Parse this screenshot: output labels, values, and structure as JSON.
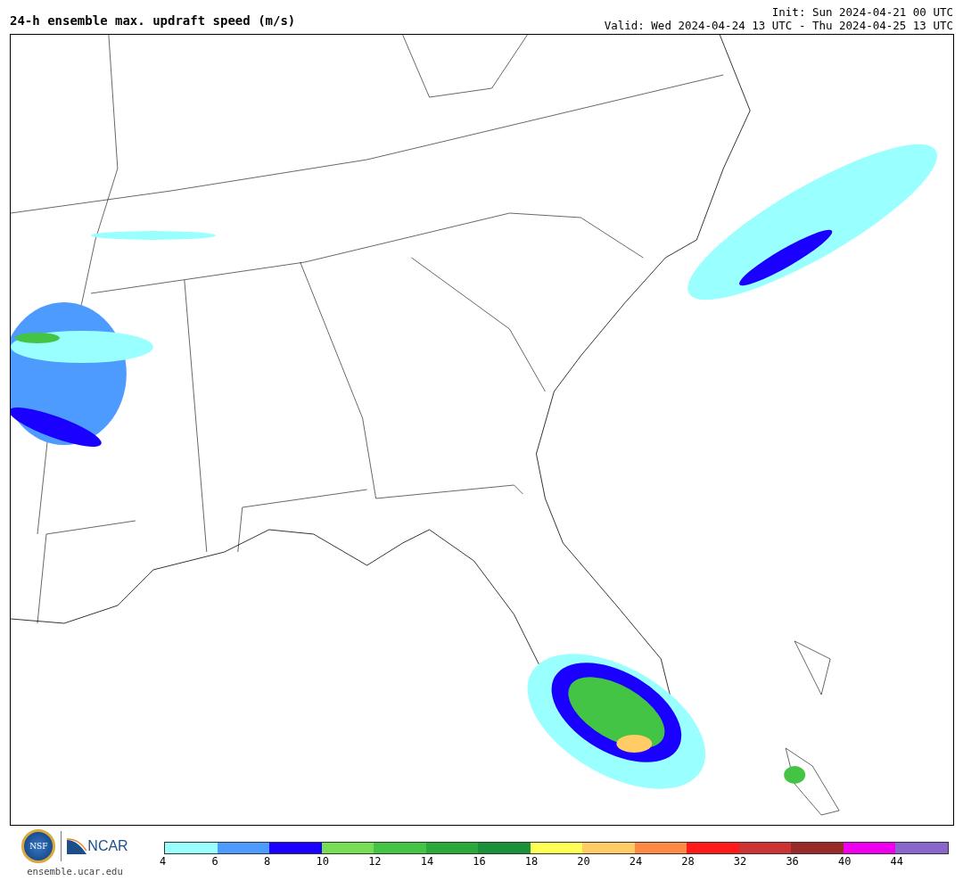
{
  "title": "24-h ensemble max. updraft speed (m/s)",
  "init": "Init: Sun 2024-04-21 00 UTC",
  "valid": "Valid: Wed 2024-04-24 13 UTC - Thu 2024-04-25 13 UTC",
  "logos": {
    "nsf": "NSF",
    "ncar": "NCAR"
  },
  "site": "ensemble.ucar.edu",
  "colorbar": [
    {
      "color": "#99ffff",
      "label": "4"
    },
    {
      "color": "#4d9bff",
      "label": "6"
    },
    {
      "color": "#1a00ff",
      "label": "8"
    },
    {
      "color": "#77dd55",
      "label": "10"
    },
    {
      "color": "#44c444",
      "label": "12"
    },
    {
      "color": "#2aa83a",
      "label": "14"
    },
    {
      "color": "#1a9038",
      "label": "16"
    },
    {
      "color": "#ffff55",
      "label": "18"
    },
    {
      "color": "#ffcc66",
      "label": "20"
    },
    {
      "color": "#ff8844",
      "label": "24"
    },
    {
      "color": "#ff1a1a",
      "label": "28"
    },
    {
      "color": "#cc3333",
      "label": "32"
    },
    {
      "color": "#992a2a",
      "label": "36"
    },
    {
      "color": "#ee00ee",
      "label": "40"
    },
    {
      "color": "#8866cc",
      "label": "44"
    }
  ]
}
